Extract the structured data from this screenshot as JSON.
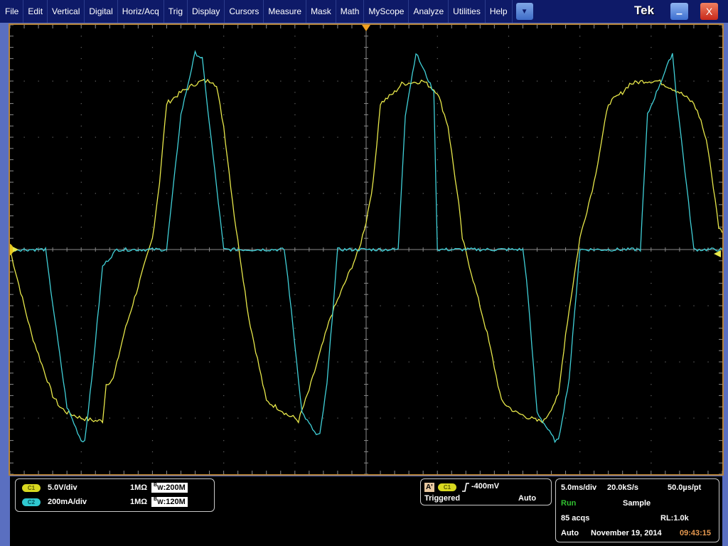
{
  "menu": {
    "items": [
      "File",
      "Edit",
      "Vertical",
      "Digital",
      "Horiz/Acq",
      "Trig",
      "Display",
      "Cursors",
      "Measure",
      "Mask",
      "Math",
      "MyScope",
      "Analyze",
      "Utilities",
      "Help"
    ],
    "dropdown_icon": "▼",
    "brand": "Tek",
    "minimize_icon": "–",
    "close_icon": "X"
  },
  "colors": {
    "ch1": "#e8e84a",
    "ch2": "#40d0d8",
    "frame": "#b5833a",
    "trigger_marker": "#f0a020",
    "time": "#e89a50",
    "run": "#30c030"
  },
  "channels": [
    {
      "chip": "C1",
      "scale": "5.0V/div",
      "impedance": "1MΩ",
      "bw_prefix": "B",
      "bw_sub": "W",
      "bw_value": ":200M"
    },
    {
      "chip": "C2",
      "scale": "200mA/div",
      "impedance": "1MΩ",
      "bw_prefix": "B",
      "bw_sub": "W",
      "bw_value": ":120M"
    }
  ],
  "trigger": {
    "label": "A'",
    "source_chip": "C1",
    "slope_icon": "rising-edge",
    "level": "-400mV",
    "state": "Triggered",
    "mode": "Auto"
  },
  "acquisition": {
    "timebase": "5.0ms/div",
    "sample_rate": "20.0kS/s",
    "resolution": "50.0µs/pt",
    "run_state": "Run",
    "acq_mode": "Sample",
    "acqs": "85 acqs",
    "record_length": "RL:1.0k",
    "trigger_mode": "Auto",
    "date": "November 19, 2014",
    "time": "09:43:15"
  },
  "graticule": {
    "ch1_marker": "1",
    "h_divisions": 10,
    "v_divisions": 8
  },
  "chart_data": {
    "type": "line",
    "title": "",
    "xlabel": "Time (5.0 ms/div)",
    "ylabel": "",
    "x_range_div": [
      -5,
      5
    ],
    "y_range_div": [
      -4,
      4
    ],
    "series": [
      {
        "name": "C1 (Voltage, 5.0V/div)",
        "color": "#e8e84a",
        "x_div": [
          -5,
          -4.7,
          -4.4,
          -4.3,
          -4.2,
          -4.0,
          -3.8,
          -3.7,
          -3.65,
          -3.55,
          -3.4,
          -3.0,
          -2.9,
          -2.8,
          -2.6,
          -2.4,
          -2.3,
          -2.15,
          -2.1,
          -2.0,
          -1.85,
          -1.65,
          -1.6,
          -1.4,
          -1.2,
          -1.1,
          -1.0,
          -0.95,
          -0.8,
          -0.5,
          -0.1,
          0.0,
          0.1,
          0.2,
          0.4,
          0.5,
          0.8,
          1.0,
          1.15,
          1.3,
          1.35,
          1.7,
          1.9,
          2.1,
          2.3,
          2.4,
          2.5,
          2.7,
          2.8,
          3.0,
          3.2,
          3.4,
          3.6,
          3.7,
          3.9,
          4.1,
          4.4,
          4.6,
          4.7,
          4.8,
          4.95,
          5.0
        ],
        "y_div": [
          0,
          -1.5,
          -2.6,
          -2.8,
          -2.9,
          -3.0,
          -3.05,
          -3.05,
          -2.4,
          -2.3,
          -1.5,
          0.2,
          1.2,
          2.6,
          2.8,
          2.95,
          3.0,
          3.0,
          2.9,
          2.2,
          0.6,
          -1.2,
          -1.5,
          -2.7,
          -2.85,
          -2.95,
          -3.0,
          -3.05,
          -2.5,
          -1.2,
          0.0,
          0.5,
          1.2,
          2.6,
          2.8,
          2.95,
          3.0,
          2.8,
          2.2,
          0.8,
          0.2,
          -1.5,
          -2.7,
          -2.9,
          -3.0,
          -3.05,
          -3.05,
          -2.6,
          -1.5,
          0.2,
          1.2,
          2.6,
          2.8,
          2.95,
          3.0,
          3.0,
          2.8,
          2.6,
          2.3,
          1.8,
          0.4,
          0.3
        ]
      },
      {
        "name": "C2 (Current, 200mA/div)",
        "color": "#40d0d8",
        "x_div": [
          -5,
          -4.5,
          -4.45,
          -4.2,
          -4.0,
          -3.95,
          -3.85,
          -3.7,
          -3.5,
          -3.3,
          -2.8,
          -2.6,
          -2.4,
          -2.3,
          -2.25,
          -2.0,
          -1.15,
          -1.1,
          -0.9,
          -0.7,
          -0.65,
          -0.55,
          -0.4,
          0.0,
          0.45,
          0.55,
          0.7,
          0.95,
          1.0,
          1.3,
          2.2,
          2.25,
          2.4,
          2.65,
          2.7,
          2.85,
          3.0,
          3.8,
          3.85,
          3.95,
          4.3,
          4.35,
          4.6,
          5.0
        ],
        "y_div": [
          0,
          0,
          -0.5,
          -2.8,
          -3.4,
          -3.4,
          -2.3,
          -0.3,
          0,
          0,
          0,
          2.4,
          3.5,
          3.4,
          2.8,
          0,
          0,
          -0.5,
          -2.9,
          -3.3,
          -3.3,
          -2.4,
          0,
          0,
          0,
          2.4,
          3.5,
          2.8,
          0,
          0,
          0,
          -0.5,
          -2.9,
          -3.4,
          -3.4,
          -2.3,
          0,
          0,
          0,
          2.4,
          3.5,
          2.8,
          0,
          0
        ]
      }
    ]
  }
}
